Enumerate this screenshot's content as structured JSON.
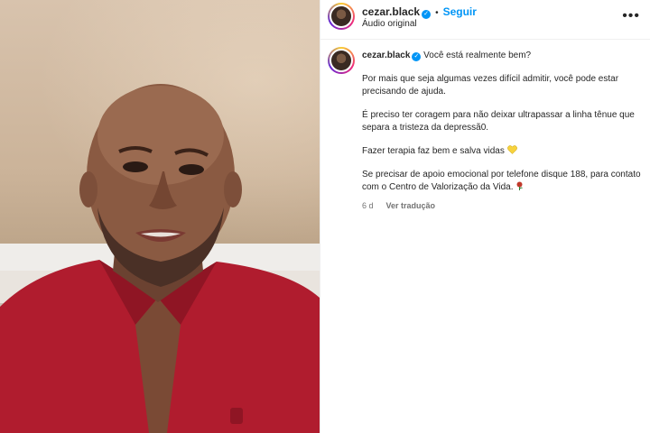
{
  "header": {
    "username": "cezar.black",
    "dot": "•",
    "follow_label": "Seguir",
    "audio_label": "Áudio original",
    "more_label": "•••"
  },
  "caption": {
    "username": "cezar.black",
    "title": "Você está realmente bem?",
    "paragraphs": [
      "Por mais que seja algumas vezes difícil admitir, você pode estar precisando de ajuda.",
      "É preciso ter coragem para não deixar ultrapassar a linha tênue que separa a tristeza da depressã0.",
      "Fazer terapia faz bem e salva vidas",
      "Se precisar de apoio emocional por telefone disque 188, para contato com o Centro de Valorização da Vida."
    ],
    "age": "6 d",
    "translate_label": "Ver tradução"
  },
  "colors": {
    "accent": "#0095f6",
    "text": "#262626",
    "muted": "#737373",
    "shirt": "#b01c2e"
  },
  "icons": {
    "verified": "verified-badge-icon",
    "heart": "yellow-heart-icon",
    "rose": "rose-icon",
    "more": "more-options-icon"
  }
}
